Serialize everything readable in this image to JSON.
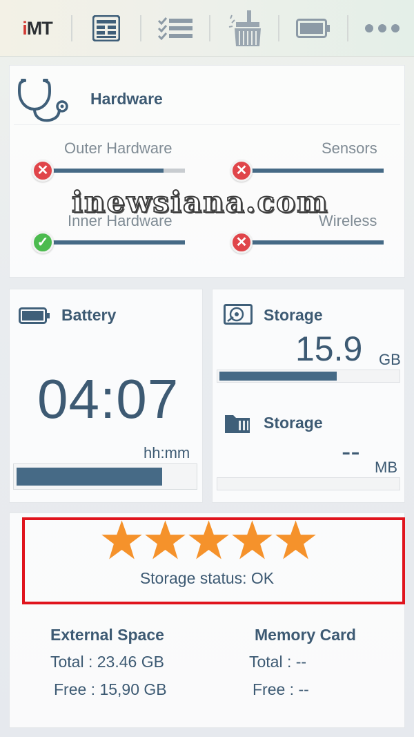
{
  "toolbar": {
    "logo_prefix": "i",
    "logo_rest": "MT",
    "icons": [
      "dashboard-icon",
      "checklist-icon",
      "broom-icon",
      "battery-icon",
      "more-icon"
    ]
  },
  "hardware": {
    "title": "Hardware",
    "items": [
      {
        "label": "Outer Hardware",
        "status": "fail",
        "level": 0.85
      },
      {
        "label": "Sensors",
        "status": "fail",
        "level": 1.0
      },
      {
        "label": "Inner Hardware",
        "status": "ok",
        "level": 1.0
      },
      {
        "label": "Wireless",
        "status": "fail",
        "level": 1.0
      }
    ]
  },
  "watermark": "inewsiana.com",
  "battery": {
    "title": "Battery",
    "time": "04:07",
    "unit": "hh:mm",
    "level": 0.82
  },
  "storage_internal": {
    "title": "Storage",
    "value": "15.9",
    "unit": "GB",
    "level": 0.66
  },
  "storage_card": {
    "title": "Storage",
    "value": "--",
    "unit": "MB",
    "level": 0
  },
  "status": {
    "rating": 5,
    "text": "Storage status: OK"
  },
  "spaces": {
    "external": {
      "title": "External Space",
      "total": "Total : 23.46 GB",
      "free": "Free : 15,90 GB"
    },
    "memory_card": {
      "title": "Memory Card",
      "total": "Total : --",
      "free": "Free : --"
    }
  },
  "colors": {
    "accent": "#466a86",
    "fail": "#e0454a",
    "ok": "#4cbb4f",
    "star": "#f5922b",
    "highlight": "#e0141d"
  }
}
